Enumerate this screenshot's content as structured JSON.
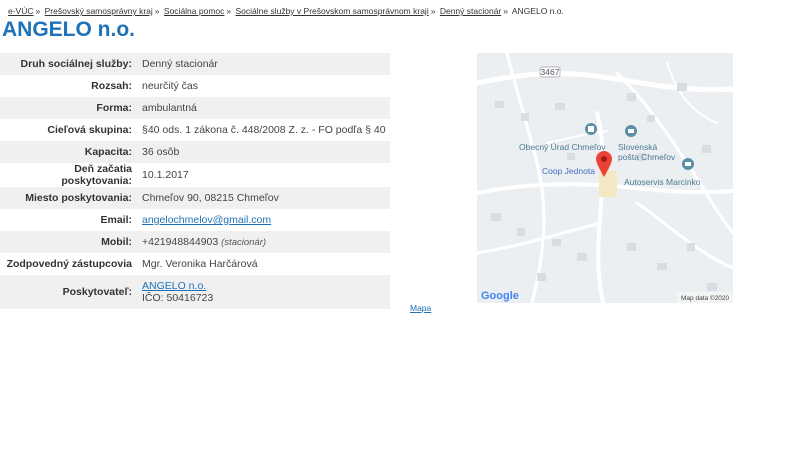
{
  "breadcrumb": {
    "items": [
      "e-VÚC",
      "Prešovský samosprávny kraj",
      "Sociálna pomoc",
      "Sociálne služby v Prešovskom samosprávnom kraji",
      "Denný stacionár"
    ],
    "current": "ANGELO n.o.",
    "separator": "»"
  },
  "title": "ANGELO n.o.",
  "details": {
    "druh": {
      "label": "Druh sociálnej služby:",
      "value": "Denný stacionár"
    },
    "rozsah": {
      "label": "Rozsah:",
      "value": "neurčitý čas"
    },
    "forma": {
      "label": "Forma:",
      "value": "ambulantná"
    },
    "skupina": {
      "label": "Cieľová skupina:",
      "value": "§40 ods. 1 zákona č. 448/2008 Z. z. - FO podľa § 40"
    },
    "kapacita": {
      "label": "Kapacita:",
      "value": "36 osôb"
    },
    "zaciatok": {
      "label": "Deň začatia poskytovania:",
      "value": "10.1.2017"
    },
    "miesto": {
      "label": "Miesto poskytovania:",
      "value": "Chmeľov 90, 08215 Chmeľov"
    },
    "email": {
      "label": "Email:",
      "value": "angelochmelov@gmail.com"
    },
    "mobil": {
      "label": "Mobil:",
      "value": "+421948844903",
      "note": "(stacionár)"
    },
    "zastupca": {
      "label": "Zodpovedný zástupcovia",
      "value": "Mgr. Veronika Harčárová"
    },
    "poskytovatel": {
      "label": "Poskytovateľ:",
      "link": "ANGELO n.o.",
      "ico": "IČO: 50416723"
    }
  },
  "map": {
    "road_badge": "3467",
    "place1": "Obecný Úrad Chmeľov",
    "place2_line1": "Slovenská",
    "place2_line2": "pošta Chmeľov",
    "place3": "Coop Jednota",
    "place4": "Autoservis Marcinko",
    "brand": "Google",
    "attribution": "Map data ©2020",
    "link_label": "Mapa",
    "colors": {
      "marker": "#ea4335",
      "poi": "#5a8fa8",
      "coop": "#3f6cc7"
    }
  }
}
